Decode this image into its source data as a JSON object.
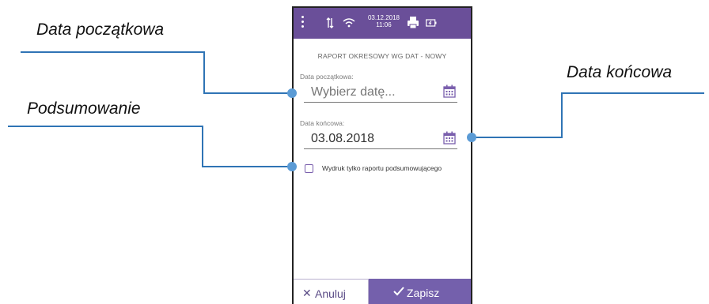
{
  "callouts": {
    "start_date": "Data początkowa",
    "summary": "Podsumowanie",
    "end_date": "Data końcowa"
  },
  "statusbar": {
    "date": "03.12.2018",
    "time": "11:06",
    "icons": [
      "menu-dots-icon",
      "usb-icon",
      "wifi-icon",
      "printer-icon",
      "battery-icon"
    ]
  },
  "screen": {
    "title": "RAPORT OKRESOWY WG DAT - NOWY",
    "start_date": {
      "label": "Data początkowa:",
      "placeholder": "Wybierz datę...",
      "icon": "calendar-icon"
    },
    "end_date": {
      "label": "Data końcowa:",
      "value": "03.08.2018",
      "icon": "calendar-icon"
    },
    "summary_checkbox": {
      "label": "Wydruk tylko raportu podsumowującego",
      "checked": false
    },
    "buttons": {
      "cancel": "Anuluj",
      "save": "Zapisz"
    }
  },
  "colors": {
    "statusbar": "#6a4f99",
    "accent": "#7460ac",
    "callout_line": "#2f74b5",
    "callout_dot": "#5b9bd5"
  }
}
